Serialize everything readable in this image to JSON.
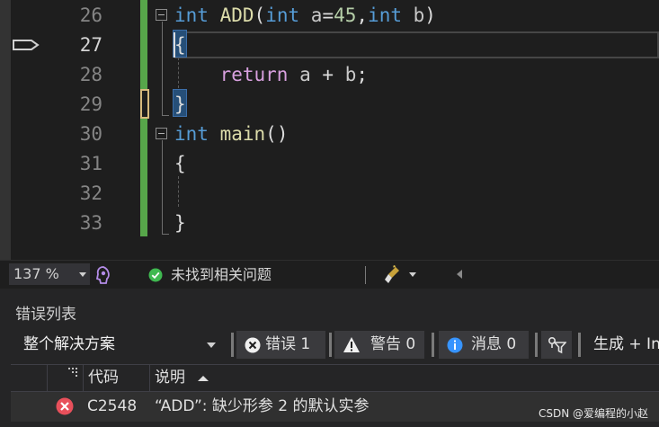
{
  "editor": {
    "lines": [
      {
        "num": "26",
        "tokens": [
          {
            "t": "int",
            "c": "kw"
          },
          {
            "t": " ",
            "c": ""
          },
          {
            "t": "ADD",
            "c": "fn"
          },
          {
            "t": "(",
            "c": ""
          },
          {
            "t": "int",
            "c": "kw"
          },
          {
            "t": " ",
            "c": ""
          },
          {
            "t": "a",
            "c": "id-plain"
          },
          {
            "t": "=",
            "c": ""
          },
          {
            "t": "45",
            "c": "num"
          },
          {
            "t": ",",
            "c": ""
          },
          {
            "t": "int",
            "c": "kw"
          },
          {
            "t": " ",
            "c": ""
          },
          {
            "t": "b",
            "c": "id-plain"
          },
          {
            "t": ")",
            "c": ""
          }
        ]
      },
      {
        "num": "27",
        "tokens": [
          {
            "t": "{",
            "c": ""
          }
        ]
      },
      {
        "num": "28",
        "tokens": [
          {
            "t": "    ",
            "c": ""
          },
          {
            "t": "return",
            "c": "ctl"
          },
          {
            "t": " ",
            "c": ""
          },
          {
            "t": "a",
            "c": "id-plain"
          },
          {
            "t": " + ",
            "c": ""
          },
          {
            "t": "b",
            "c": "id-plain"
          },
          {
            "t": ";",
            "c": ""
          }
        ]
      },
      {
        "num": "29",
        "tokens": [
          {
            "t": "}",
            "c": ""
          }
        ]
      },
      {
        "num": "30",
        "tokens": [
          {
            "t": "int",
            "c": "kw"
          },
          {
            "t": " ",
            "c": ""
          },
          {
            "t": "main",
            "c": "fn"
          },
          {
            "t": "()",
            "c": ""
          }
        ]
      },
      {
        "num": "31",
        "tokens": [
          {
            "t": "{",
            "c": ""
          }
        ]
      },
      {
        "num": "32",
        "tokens": [
          {
            "t": "",
            "c": ""
          }
        ]
      },
      {
        "num": "33",
        "tokens": [
          {
            "t": "}",
            "c": ""
          }
        ]
      }
    ],
    "current_line": "27"
  },
  "status": {
    "zoom": "137 %",
    "issues_text": "未找到相关问题"
  },
  "error_list": {
    "title": "错误列表",
    "scope": "整个解决方案",
    "errors_label": "错误 1",
    "warnings_label": "警告 0",
    "messages_label": "消息 0",
    "build_label": "生成 + In",
    "columns": {
      "code": "代码",
      "description": "说明"
    },
    "rows": [
      {
        "code": "C2548",
        "description": "“ADD”: 缺少形参 2 的默认实参"
      }
    ]
  },
  "watermark": "CSDN @爱编程的小赵",
  "colors": {
    "keyword": "#569cd6",
    "function": "#dcdcaa",
    "control": "#d8a0df",
    "change_bar": "#57a64a",
    "error": "#e8505b"
  }
}
